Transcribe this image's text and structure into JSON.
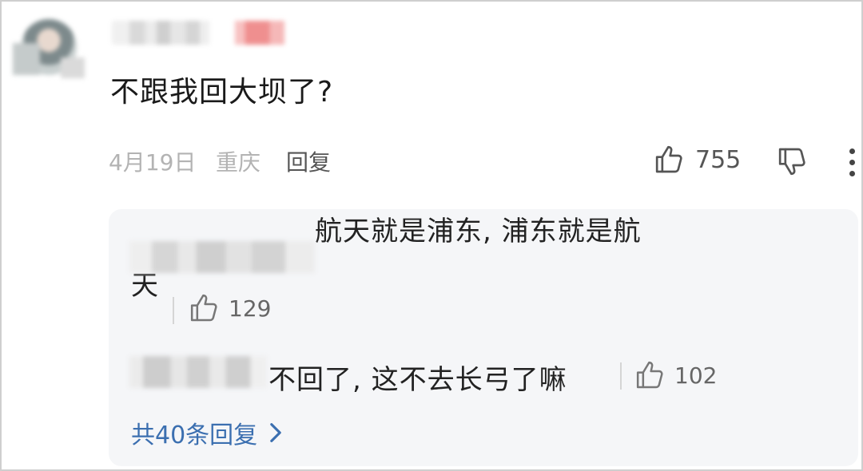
{
  "comment": {
    "text": "不跟我回大坝了?",
    "date": "4月19日",
    "location": "重庆",
    "reply_label": "回复",
    "likes": "755"
  },
  "icons": {
    "like": "thumbs-up-icon",
    "dislike": "thumbs-down-icon",
    "more": "more-vertical-icon",
    "expand": "chevron-right-icon"
  },
  "replies": [
    {
      "text_line1": "航天就是浦东, 浦东就是航",
      "text_line2": "天",
      "likes": "129"
    },
    {
      "text": "不回了, 这不去长弓了嘛",
      "likes": "102"
    }
  ],
  "replies_footer": {
    "label": "共40条回复"
  },
  "colors": {
    "link": "#3b6fb0",
    "meta": "#b3b3b3",
    "reply_bg": "#f5f6f8"
  }
}
